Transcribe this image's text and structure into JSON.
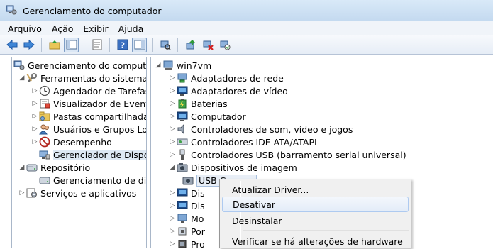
{
  "window": {
    "title": "Gerenciamento do computador"
  },
  "menu": [
    "Arquivo",
    "Ação",
    "Exibir",
    "Ajuda"
  ],
  "toolbar": {
    "buttons": [
      "back-arrow-icon",
      "forward-arrow-icon",
      "up-folder-icon",
      "show-hide-tree-icon",
      "properties-icon",
      "help-icon",
      "action-pane-icon",
      "scan-hardware-icon",
      "update-driver-icon",
      "uninstall-icon",
      "enable-device-icon"
    ]
  },
  "left_tree": {
    "root": "Gerenciamento do computado",
    "system_tools": "Ferramentas do sistema",
    "task_scheduler": "Agendador de Tarefas",
    "event_viewer": "Visualizador de Eventos",
    "shared_folders": "Pastas compartilhadas",
    "users_groups": "Usuários e Grupos Loca",
    "performance": "Desempenho",
    "device_manager": "Gerenciador de Disposit",
    "storage": "Repositório",
    "disk_management": "Gerenciamento de disco",
    "services_apps": "Serviços e aplicativos"
  },
  "device_tree": {
    "computer": "win7vm",
    "categories": [
      "Adaptadores de rede",
      "Adaptadores de vídeo",
      "Baterias",
      "Computador",
      "Controladores de som, vídeo e jogos",
      "Controladores IDE ATA/ATAPI",
      "Controladores USB (barramento serial universal)",
      "Dispositivos de imagem"
    ],
    "selected_device": "USB Camera",
    "partial_items": [
      "Dis",
      "Dis",
      "Mo",
      "Por",
      "Pro"
    ]
  },
  "context_menu": {
    "update_driver": "Atualizar Driver...",
    "disable": "Desativar",
    "uninstall": "Desinstalar",
    "scan_changes": "Verificar se há alterações de hardware"
  }
}
